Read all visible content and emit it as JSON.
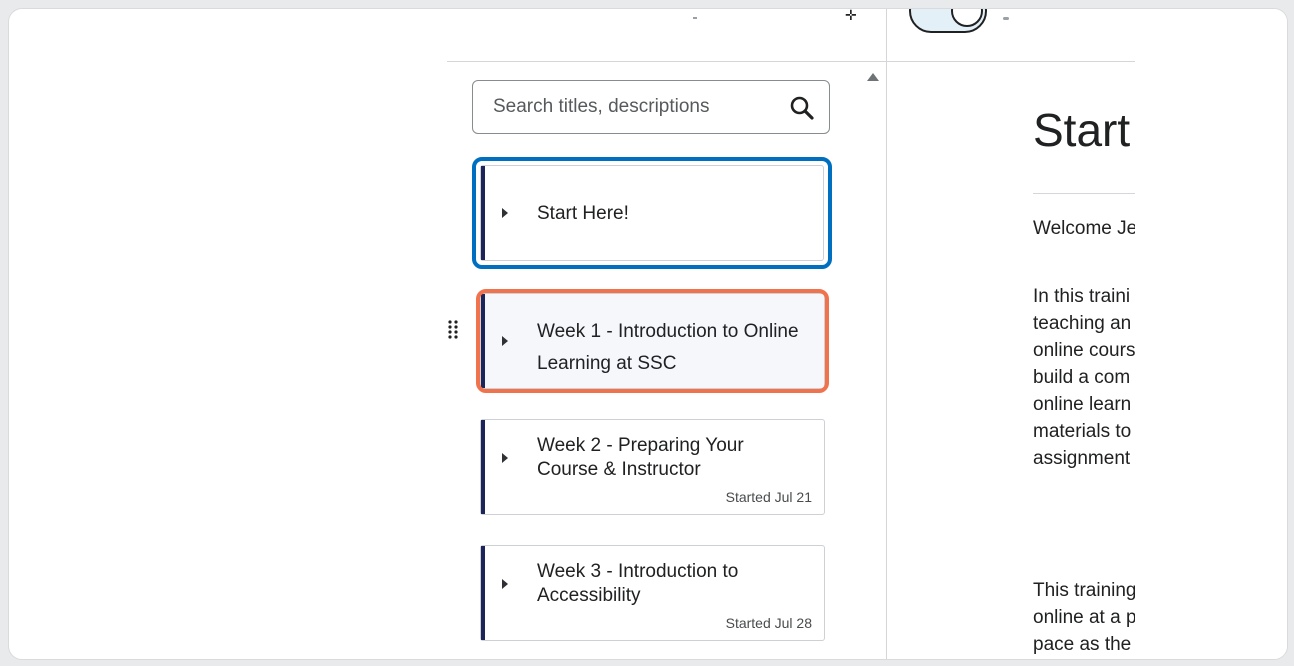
{
  "search": {
    "placeholder": "Search titles, descriptions"
  },
  "modules": [
    {
      "title": "Start Here!",
      "meta": ""
    },
    {
      "title": "Week 1 - Introduction to Online Learning at SSC",
      "meta": ""
    },
    {
      "title": "Week 2 - Preparing Your Course & Instructor",
      "meta": "Started Jul 21"
    },
    {
      "title": "Week 3 - Introduction to Accessibility",
      "meta": "Started Jul 28"
    }
  ],
  "content": {
    "title": "Start",
    "paragraphs": [
      [
        "Welcome Je"
      ],
      [
        "In this traini",
        "teaching an",
        "online cours",
        "build a com",
        "online learn",
        "materials to",
        "assignment"
      ],
      [
        "This training",
        "online at a p",
        "pace as the"
      ]
    ]
  },
  "colors": {
    "focus_outline": "#006fbf",
    "highlight_outline": "#f0734d",
    "module_bar": "#1d2459"
  }
}
